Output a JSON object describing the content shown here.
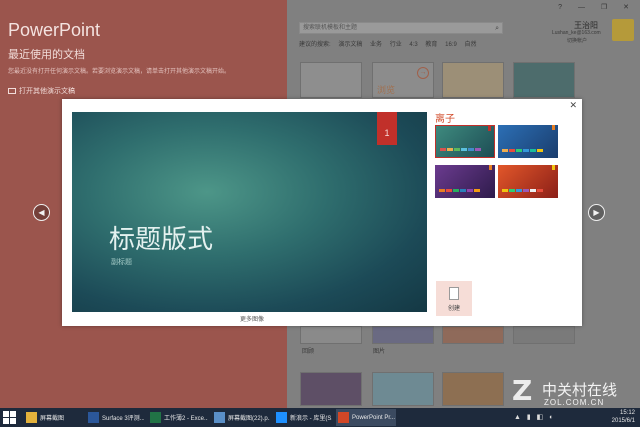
{
  "app": {
    "title": "PowerPoint",
    "recent_heading": "最近使用的文档",
    "recent_hint": "您最近没有打开任何演示文稿。若要浏览演示文稿，请单击打开其他演示文稿开始。",
    "open_other": "打开其他演示文稿"
  },
  "window_controls": "? — ❐ ✕",
  "search": {
    "placeholder": "搜索联机模板和主题",
    "suggest_label": "建议的搜索:",
    "suggestions": [
      "演示文稿",
      "业务",
      "行业",
      "4:3",
      "教育",
      "16:9",
      "自然"
    ]
  },
  "user": {
    "name": "王治阳",
    "email": "Lushan_ke@163.com",
    "switch": "切换帐户"
  },
  "background_labels": [
    "回顾",
    "图片",
    "",
    "",
    ""
  ],
  "background_thumb_text": "浏览",
  "modal": {
    "close": "✕",
    "slide_number": "1",
    "slide_title": "标题版式",
    "slide_subtitle": "副标题",
    "caption": "更多图像",
    "theme_name": "离子",
    "create_label": "创建",
    "variants": [
      {
        "name": "teal",
        "colors": [
          "#d9534f",
          "#f0ad4e",
          "#5cb85c",
          "#5bc0de",
          "#428bca",
          "#9b59b6"
        ]
      },
      {
        "name": "blue",
        "colors": [
          "#f0ad4e",
          "#e74c3c",
          "#2ecc71",
          "#3498db",
          "#1abc9c",
          "#f1c40f"
        ]
      },
      {
        "name": "purple",
        "colors": [
          "#e67e22",
          "#e74c3c",
          "#27ae60",
          "#2980b9",
          "#8e44ad",
          "#f39c12"
        ]
      },
      {
        "name": "orange",
        "colors": [
          "#f1c40f",
          "#2ecc71",
          "#3498db",
          "#9b59b6",
          "#ecf0f1",
          "#e74c3c"
        ]
      }
    ]
  },
  "nav": {
    "prev": "◀",
    "next": "▶"
  },
  "taskbar": {
    "items": [
      {
        "label": "屏幕截图",
        "color": "#e3b23c"
      },
      {
        "label": "Surface 3评测...",
        "color": "#2b579a"
      },
      {
        "label": "工作薄2 - Exce...",
        "color": "#217346"
      },
      {
        "label": "屏幕截图(22).p...",
        "color": "#5a8fc7"
      },
      {
        "label": "新浪示 - 库里(S...",
        "color": "#1e90ff"
      },
      {
        "label": "PowerPoint Pr...",
        "color": "#d24726"
      }
    ],
    "time": "15:12",
    "date": "2015/6/1"
  },
  "watermark": {
    "logo": "Z",
    "name": "中关村在线",
    "url": "ZOL.COM.CN"
  },
  "colors": {
    "left_pane": "#9b554d",
    "accent": "#d24c2b",
    "slide_number_bg": "#c1302a",
    "taskbar": "#1e2a3c"
  }
}
